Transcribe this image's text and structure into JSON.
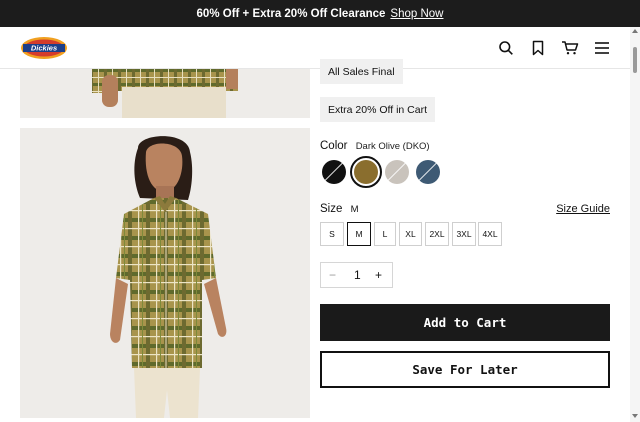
{
  "promo": {
    "message": "60% Off + Extra 20% Off Clearance",
    "link": "Shop Now"
  },
  "header": {
    "logo_text": "Dickies",
    "icons": [
      "search-icon",
      "bookmark-icon",
      "cart-icon",
      "menu-icon"
    ]
  },
  "badges": [
    "All Sales Final",
    "Extra 20% Off in Cart"
  ],
  "color": {
    "label": "Color",
    "selected": "Dark Olive (DKO)",
    "swatches": [
      {
        "name": "black",
        "hex": "#111111",
        "unavailable": true
      },
      {
        "name": "dark-olive",
        "hex": "#8a6e2e",
        "selected": true
      },
      {
        "name": "light-gray",
        "hex": "#c9c3bc",
        "unavailable": true
      },
      {
        "name": "slate-blue",
        "hex": "#3e5a74",
        "unavailable": true
      }
    ]
  },
  "size": {
    "label": "Size",
    "selected": "M",
    "guide": "Size Guide",
    "options": [
      "S",
      "M",
      "L",
      "XL",
      "2XL",
      "3XL",
      "4XL"
    ]
  },
  "quantity": {
    "minus": "−",
    "value": "1",
    "plus": "+"
  },
  "actions": {
    "add_to_cart": "Add to Cart",
    "save_for_later": "Save For Later"
  },
  "colors": {
    "promo_bg": "#1c1c1c",
    "badge_bg": "#f0f0f0",
    "primary": "#1a1a1a",
    "gallery_bg": "#eeece9"
  }
}
